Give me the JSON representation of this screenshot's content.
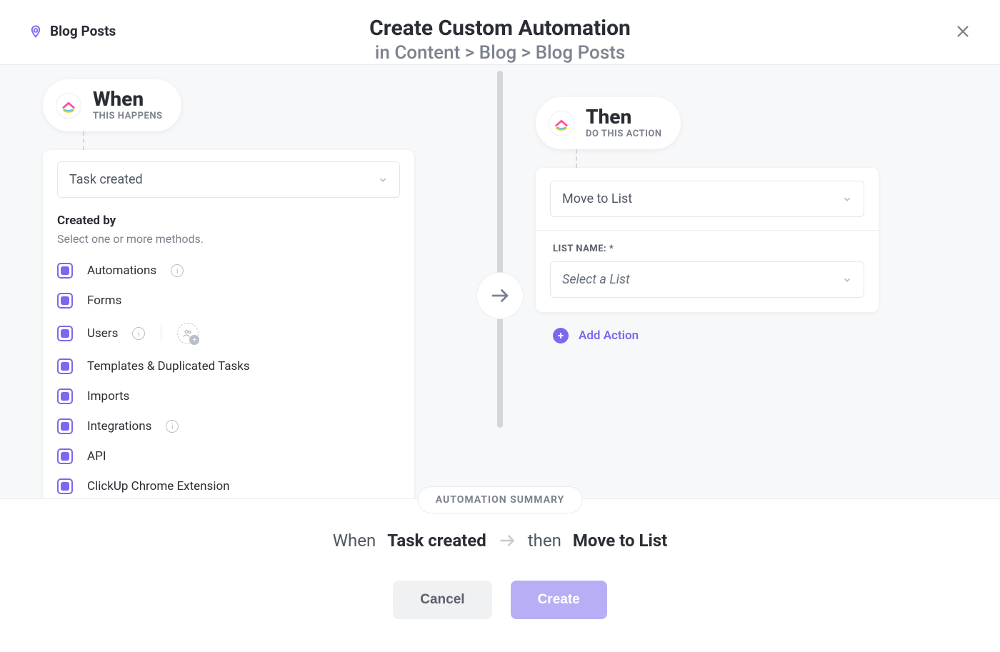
{
  "header": {
    "location_label": "Blog Posts",
    "title": "Create Custom Automation",
    "breadcrumb_prefix": "in ",
    "breadcrumb": "Content > Blog > Blog Posts"
  },
  "when": {
    "title": "When",
    "subtitle": "THIS HAPPENS",
    "trigger_selected": "Task created",
    "created_by_label": "Created by",
    "created_by_hint": "Select one or more methods.",
    "methods": [
      {
        "label": "Automations",
        "info": true
      },
      {
        "label": "Forms",
        "info": false
      },
      {
        "label": "Users",
        "info": true,
        "people": true
      },
      {
        "label": "Templates & Duplicated Tasks",
        "info": false
      },
      {
        "label": "Imports",
        "info": false
      },
      {
        "label": "Integrations",
        "info": true
      },
      {
        "label": "API",
        "info": false
      },
      {
        "label": "ClickUp Chrome Extension",
        "info": false
      }
    ]
  },
  "then": {
    "title": "Then",
    "subtitle": "DO THIS ACTION",
    "action_selected": "Move to List",
    "list_field_label": "LIST NAME: *",
    "list_placeholder": "Select a List",
    "add_action_label": "Add Action"
  },
  "summary": {
    "pill": "AUTOMATION SUMMARY",
    "when_prefix": "When",
    "when_value": "Task created",
    "then_prefix": "then",
    "then_value": "Move to List"
  },
  "buttons": {
    "cancel": "Cancel",
    "create": "Create"
  }
}
